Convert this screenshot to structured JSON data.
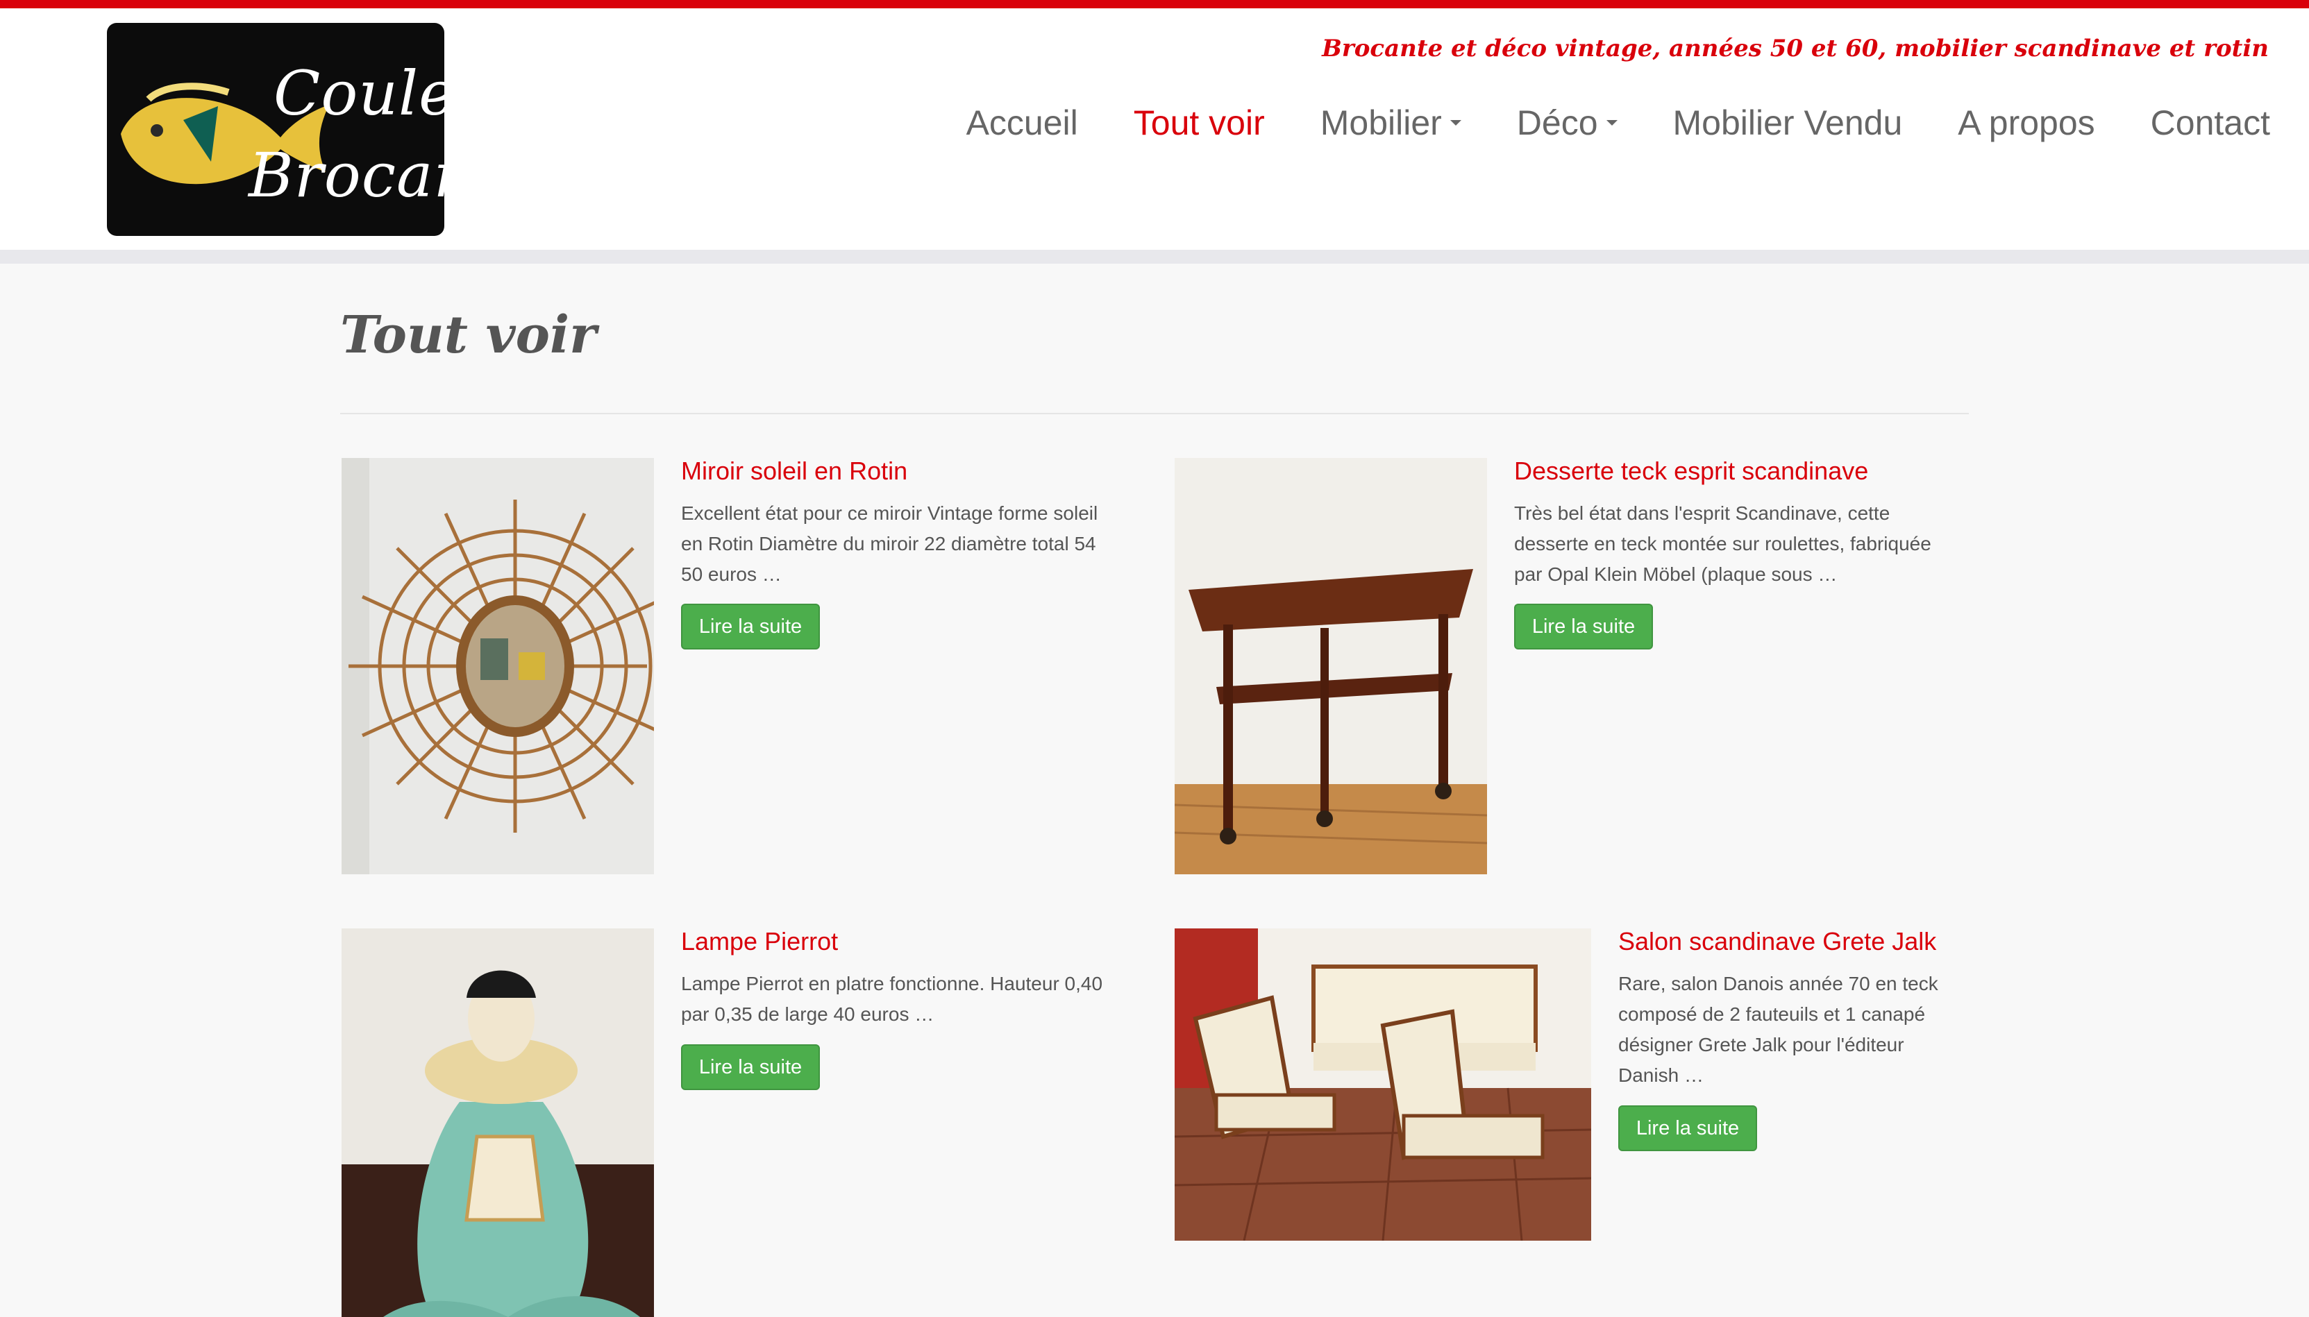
{
  "site": {
    "logo_line1": "Couleur",
    "logo_line2": "Brocante",
    "tagline": "Brocante et déco vintage, années 50 et 60, mobilier scandinave et rotin"
  },
  "nav": {
    "items": [
      {
        "label": "Accueil"
      },
      {
        "label": "Tout voir",
        "active": true
      },
      {
        "label": "Mobilier",
        "dropdown": true
      },
      {
        "label": "Déco",
        "dropdown": true
      },
      {
        "label": "Mobilier Vendu"
      },
      {
        "label": "A propos"
      },
      {
        "label": "Contact"
      }
    ]
  },
  "page": {
    "title": "Tout voir"
  },
  "posts": [
    {
      "title": "Miroir soleil en  Rotin",
      "excerpt_lines": [
        "Excellent état pour ce miroir Vintage forme soleil",
        "en Rotin  Diamètre du miroir 22 diamètre total 54",
        "50 euros  …"
      ],
      "button": "Lire la suite"
    },
    {
      "title": "Desserte teck esprit scandinave",
      "excerpt_lines": [
        "Très bel état dans l'esprit Scandinave, cette",
        "desserte en teck montée sur roulettes, fabriquée",
        "par Opal Klein Möbel (plaque sous …"
      ],
      "button": "Lire la suite"
    },
    {
      "title": "Lampe Pierrot",
      "excerpt_lines": [
        "Lampe Pierrot en platre fonctionne. Hauteur 0,40",
        "par 0,35 de large  40 euros  …"
      ],
      "button": "Lire la suite"
    },
    {
      "title": "Salon scandinave Grete Jalk",
      "excerpt_lines": [
        "Rare, salon Danois année 70 en teck",
        "composé de 2 fauteuils et 1 canapé",
        "désigner Grete Jalk pour l'éditeur",
        "Danish …"
      ],
      "button": "Lire la suite"
    }
  ],
  "colors": {
    "brand_red": "#d9000b",
    "button_green": "#4cae4c",
    "nav_text": "#666666"
  }
}
